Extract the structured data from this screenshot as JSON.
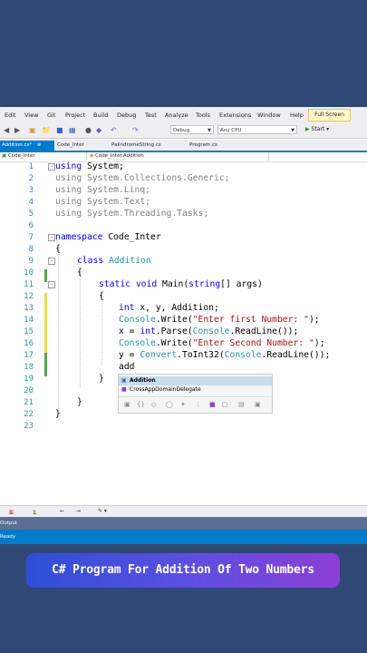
{
  "menu": {
    "items": [
      "Edit",
      "View",
      "Git",
      "Project",
      "Build",
      "Debug",
      "Test",
      "Analyze",
      "Tools",
      "Extensions",
      "Window",
      "Help"
    ],
    "full_screen": "Full Screen"
  },
  "toolbar": {
    "config": "Debug",
    "platform": "Any CPU",
    "start": "Start"
  },
  "tabs": [
    {
      "label": "Addition.cs*",
      "active": true
    },
    {
      "label": "Code_Inter",
      "active": false
    },
    {
      "label": "PalindromeString.cs",
      "active": false
    },
    {
      "label": "Program.cs",
      "active": false
    }
  ],
  "navbar": {
    "project": "Code_Inter",
    "class": "Code_Inter.Addition"
  },
  "editor": {
    "lines": [
      {
        "n": "1",
        "segs": [
          [
            "kw",
            "using"
          ],
          [
            "",
            "System;"
          ]
        ]
      },
      {
        "n": "2",
        "segs": [
          [
            "gray",
            "using"
          ],
          [
            "gray",
            "System.Collections.Generic;"
          ]
        ]
      },
      {
        "n": "3",
        "segs": [
          [
            "gray",
            "using"
          ],
          [
            "gray",
            "System.Linq;"
          ]
        ]
      },
      {
        "n": "4",
        "segs": [
          [
            "gray",
            "using"
          ],
          [
            "gray",
            "System.Text;"
          ]
        ]
      },
      {
        "n": "5",
        "segs": [
          [
            "gray",
            "using"
          ],
          [
            "gray",
            "System.Threading.Tasks;"
          ]
        ]
      },
      {
        "n": "6",
        "segs": []
      },
      {
        "n": "7",
        "segs": [
          [
            "kw",
            "namespace"
          ],
          [
            "",
            "Code_Inter"
          ]
        ]
      },
      {
        "n": "8",
        "segs": [
          [
            "",
            "{"
          ]
        ]
      },
      {
        "n": "9",
        "segs": [
          [
            "kw",
            "class"
          ],
          [
            "ty",
            "Addition"
          ]
        ]
      },
      {
        "n": "10",
        "segs": [
          [
            "",
            "{"
          ]
        ]
      },
      {
        "n": "11",
        "segs": [
          [
            "kw",
            "static void"
          ],
          [
            "",
            "Main("
          ],
          [
            "kw",
            "string"
          ],
          [
            "",
            "[] args)"
          ]
        ]
      },
      {
        "n": "12",
        "segs": [
          [
            "",
            "{"
          ]
        ]
      },
      {
        "n": "13",
        "segs": [
          [
            "kw",
            "int"
          ],
          [
            "",
            "x, y, Addition;"
          ]
        ]
      },
      {
        "n": "14",
        "segs": [
          [
            "ty",
            "Console"
          ],
          [
            "",
            ".Write("
          ],
          [
            "st",
            "\"Enter first Number: \""
          ],
          [
            "",
            ");"
          ]
        ]
      },
      {
        "n": "15",
        "segs": [
          [
            "",
            "x = "
          ],
          [
            "kw",
            "int"
          ],
          [
            "",
            ".Parse("
          ],
          [
            "ty",
            "Console"
          ],
          [
            "",
            ".ReadLine());"
          ]
        ]
      },
      {
        "n": "16",
        "segs": [
          [
            "ty",
            "Console"
          ],
          [
            "",
            ".Write("
          ],
          [
            "st",
            "\"Enter Second Number: \""
          ],
          [
            "",
            ");"
          ]
        ]
      },
      {
        "n": "17",
        "segs": [
          [
            "",
            "y = "
          ],
          [
            "ty",
            "Convert"
          ],
          [
            "",
            ".ToInt32("
          ],
          [
            "ty",
            "Console"
          ],
          [
            "",
            ".ReadLine());"
          ]
        ]
      },
      {
        "n": "18",
        "segs": [
          [
            "",
            "add"
          ]
        ]
      },
      {
        "n": "19",
        "segs": [
          [
            "",
            "}"
          ]
        ]
      },
      {
        "n": "20",
        "segs": []
      },
      {
        "n": "21",
        "segs": [
          [
            "",
            "}"
          ]
        ]
      },
      {
        "n": "22",
        "segs": [
          [
            "",
            "}"
          ]
        ]
      },
      {
        "n": "23",
        "segs": []
      }
    ]
  },
  "completion": {
    "items": [
      "Addition",
      "CrossAppDomainDelegate"
    ]
  },
  "status": {
    "errors": "1",
    "warnings": "1"
  },
  "output_label": "Output",
  "ready_label": "Ready",
  "caption": "C# Program For Addition Of Two Numbers",
  "colors": {
    "background": "#2f4875",
    "accent": "#007acc",
    "keyword": "#0000ff",
    "type": "#2b91af",
    "string": "#a31515"
  }
}
